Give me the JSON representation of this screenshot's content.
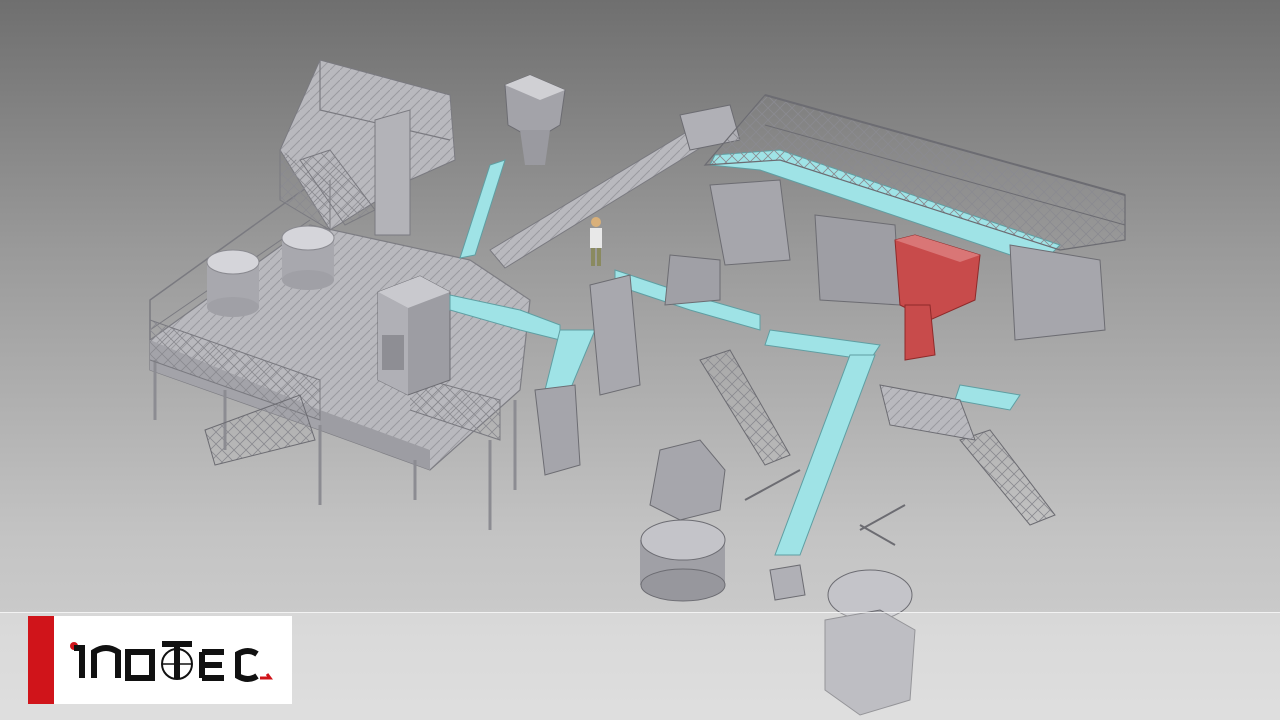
{
  "logo": {
    "wordmark": "inotec",
    "brand_color": "#d0141a"
  },
  "colors": {
    "background_top": "#6f6f6f",
    "background_bottom": "#d2d2d2",
    "structure": "#b8b8bd",
    "conveyor": "#9fe3e6",
    "highlight_machine": "#c84b4b"
  }
}
